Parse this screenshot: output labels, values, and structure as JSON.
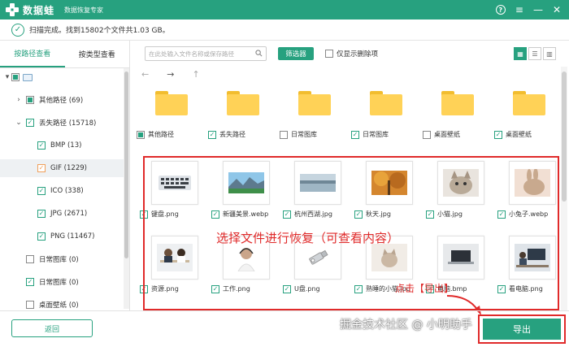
{
  "app": {
    "name": "数据蛙",
    "subtitle": "数据恢复专家",
    "help": "?",
    "menu": "≡",
    "minimize": "—",
    "close": "✕"
  },
  "status": {
    "text": "扫描完成。找到15802个文件共1.03 GB。"
  },
  "sidebar": {
    "tabs": [
      "按路径查看",
      "按类型查看"
    ],
    "tree": [
      {
        "label": "",
        "state": "partial"
      },
      {
        "label": "其他路径 (69)",
        "state": "partial",
        "arrow": "›"
      },
      {
        "label": "丢失路径 (15718)",
        "state": "checked",
        "arrow": "⌄"
      },
      {
        "label": "BMP (13)",
        "state": "checked"
      },
      {
        "label": "GIF (1229)",
        "state": "checked"
      },
      {
        "label": "ICO (338)",
        "state": "checked"
      },
      {
        "label": "JPG (2671)",
        "state": "checked"
      },
      {
        "label": "PNG (11467)",
        "state": "checked"
      },
      {
        "label": "日常图库 (0)",
        "state": "empty"
      },
      {
        "label": "日常图库 (0)",
        "state": "checked"
      },
      {
        "label": "桌面壁纸 (0)",
        "state": "empty"
      }
    ]
  },
  "toolbar": {
    "search_placeholder": "在此处输入文件名称或保存路径",
    "filter_label": "筛选器",
    "deleted_only_label": "仅显示删除项"
  },
  "nav": {
    "back": "←",
    "forward": "→",
    "up": "↑"
  },
  "folders": [
    {
      "name": "其他路径"
    },
    {
      "name": "丢失路径"
    },
    {
      "name": "日常图库"
    },
    {
      "name": "日常图库"
    },
    {
      "name": "桌面壁纸"
    },
    {
      "name": "桌面壁纸"
    }
  ],
  "files_row1": [
    {
      "name": "键盘.png",
      "icon": "keyboard-image"
    },
    {
      "name": "新疆美景.webp",
      "icon": "landscape-image"
    },
    {
      "name": "杭州西湖.jpg",
      "icon": "lake-image"
    },
    {
      "name": "秋天.jpg",
      "icon": "autumn-image"
    },
    {
      "name": "小猫.jpg",
      "icon": "kitten-image"
    },
    {
      "name": "小兔子.webp",
      "icon": "rabbit-image"
    }
  ],
  "files_row2": [
    {
      "name": "资源.png",
      "icon": "office-image"
    },
    {
      "name": "工作.png",
      "icon": "headset-image"
    },
    {
      "name": "U盘.png",
      "icon": "usb-image"
    },
    {
      "name": "熟睡的小猫.jpg",
      "icon": "sleeping-cat-image"
    },
    {
      "name": "电脑.bmp",
      "icon": "laptop-image"
    },
    {
      "name": "看电脑.png",
      "icon": "desk-image"
    }
  ],
  "overlay": {
    "select_hint": "选择文件进行恢复（可查看内容）",
    "export_hint": "点击【导出】"
  },
  "footer": {
    "back_label": "返回",
    "watermark": "掘金技术社区 @ 小明助手",
    "export_label": "导出"
  },
  "colors": {
    "accent": "#27a17f",
    "highlight": "#e02a2a",
    "folder": "#ffd257"
  }
}
